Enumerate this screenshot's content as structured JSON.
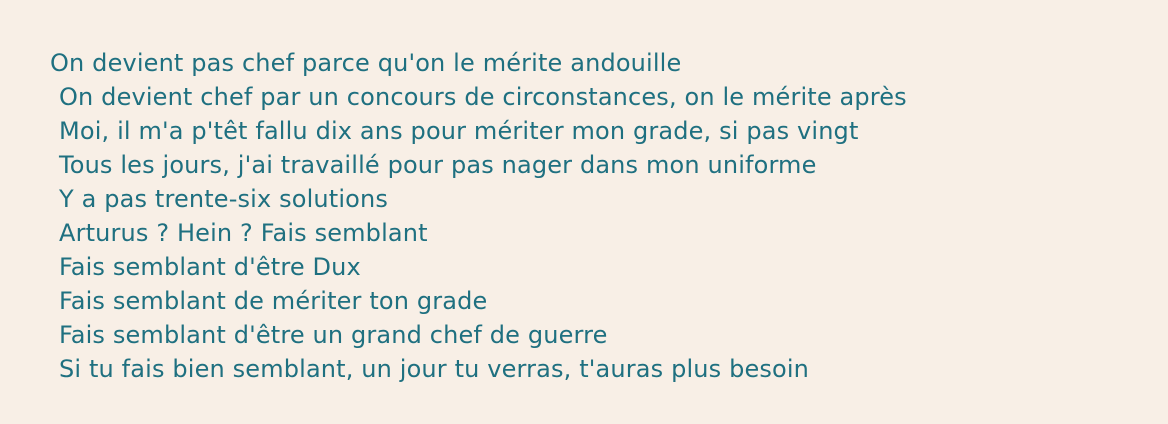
{
  "text_color": "#1f7080",
  "background_color": "#f8efe6",
  "lines": [
    "On devient pas chef parce qu'on le mérite andouille",
    "On devient chef par un concours de circonstances, on le mérite après",
    "Moi, il m'a p'têt fallu dix ans pour mériter mon grade, si pas vingt",
    "Tous les jours, j'ai travaillé pour pas nager dans mon uniforme",
    "Y a pas trente-six solutions",
    "Arturus ? Hein ? Fais semblant",
    "Fais semblant d'être Dux",
    "Fais semblant de mériter ton grade",
    "Fais semblant d'être un grand chef de guerre",
    "Si tu fais bien semblant, un jour tu verras, t'auras plus besoin"
  ]
}
